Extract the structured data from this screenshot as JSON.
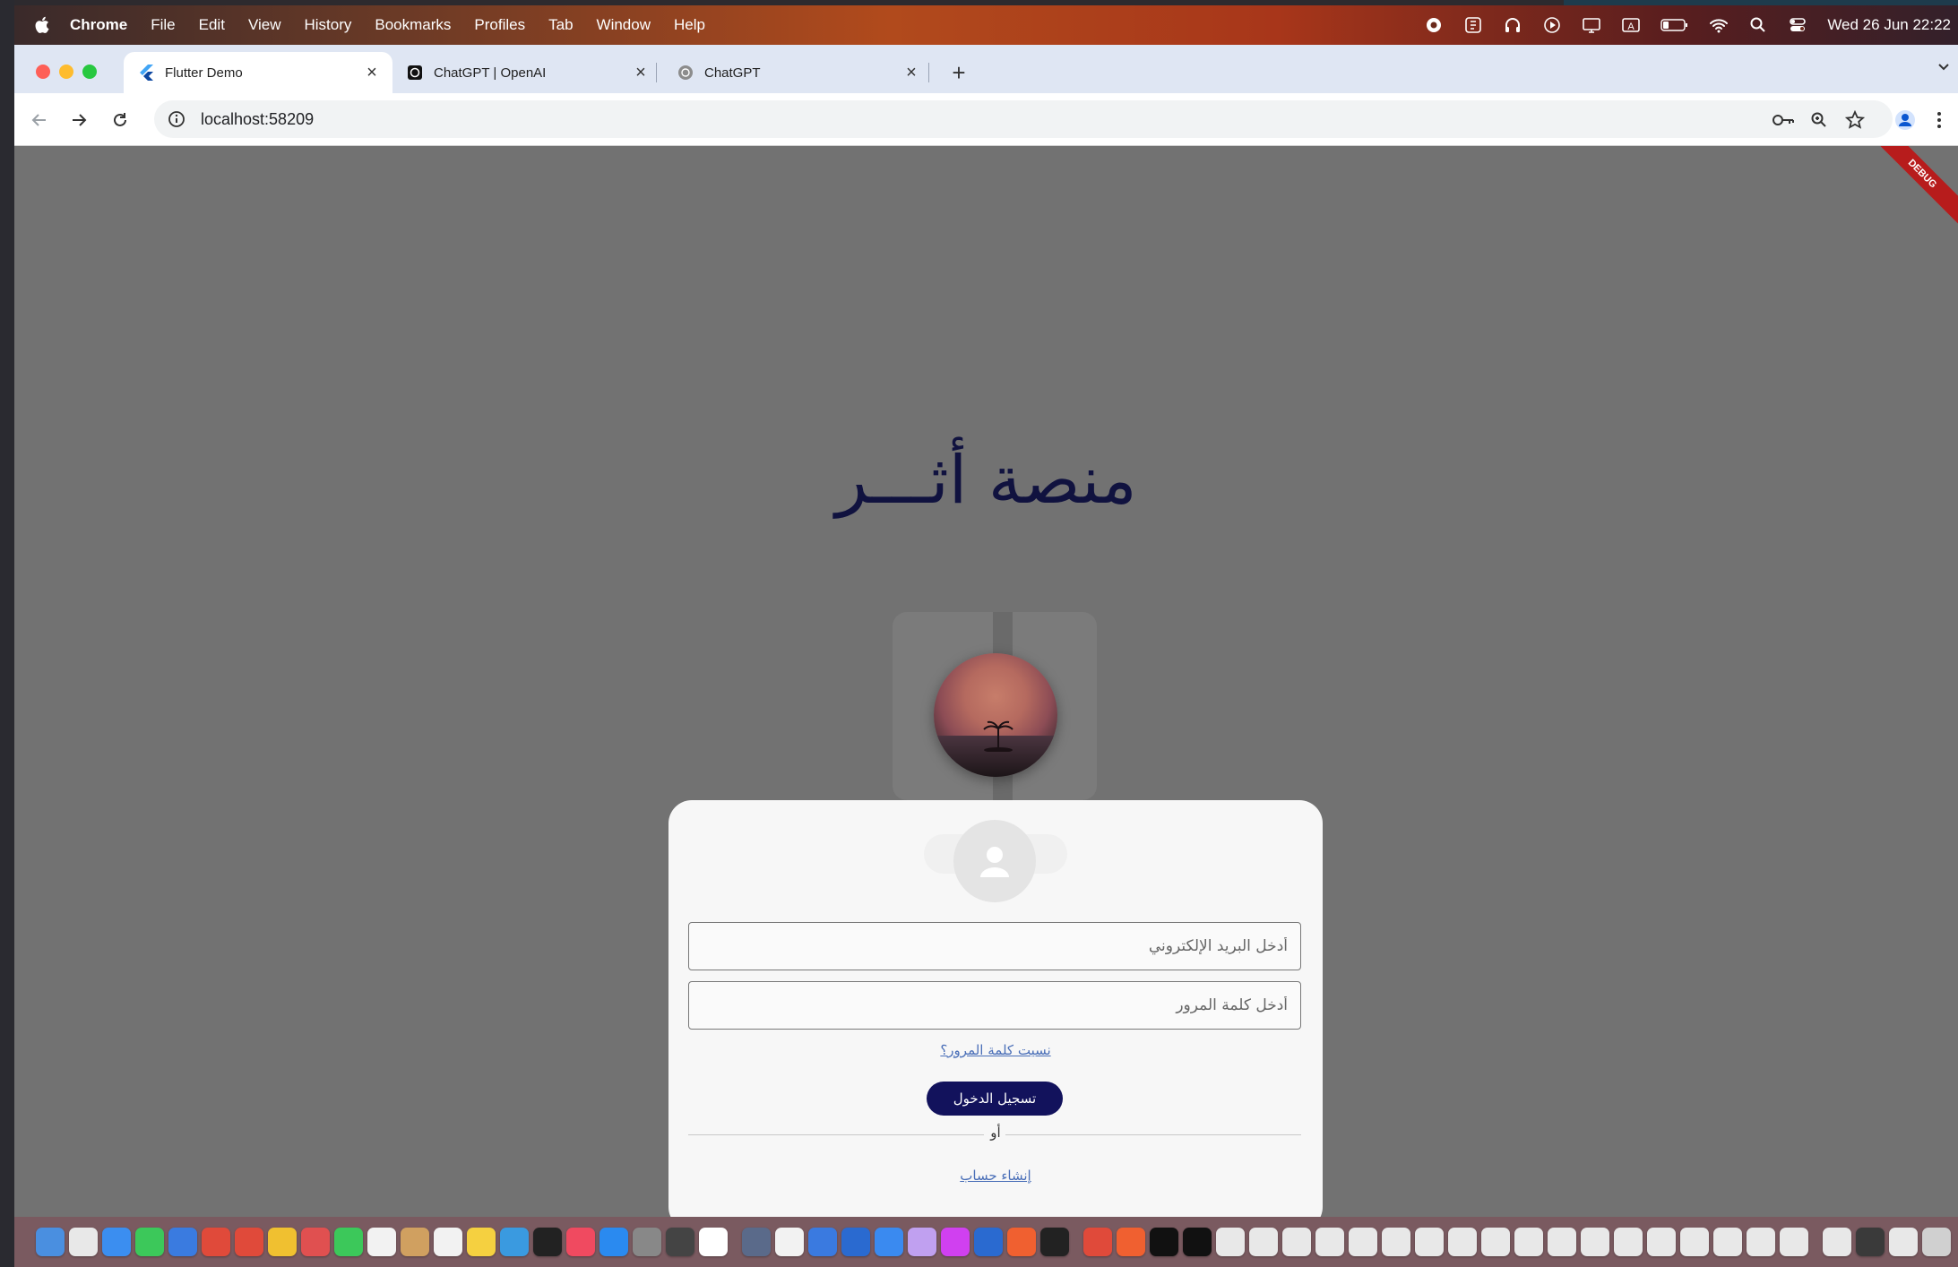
{
  "menubar": {
    "app_name": "Chrome",
    "items": [
      "File",
      "Edit",
      "View",
      "History",
      "Bookmarks",
      "Profiles",
      "Tab",
      "Window",
      "Help"
    ],
    "clock": "Wed 26 Jun  22:22",
    "status_icons": [
      "record-icon",
      "notes-icon",
      "headphones-icon",
      "play-icon",
      "display-icon",
      "keyboard-input-icon",
      "battery-icon",
      "wifi-icon",
      "search-icon",
      "control-center-icon"
    ]
  },
  "browser": {
    "tabs": [
      {
        "label": "Flutter Demo",
        "icon": "flutter-icon",
        "active": true
      },
      {
        "label": "ChatGPT | OpenAI",
        "icon": "openai-icon",
        "active": false
      },
      {
        "label": "ChatGPT",
        "icon": "openai-icon",
        "active": false
      }
    ],
    "tab_close": "×",
    "new_tab": "+",
    "url": "localhost:58209"
  },
  "page": {
    "title": "منصة أثـــر",
    "debug_banner": "DEBUG",
    "email_placeholder": "أدخل البريد الإلكتروني",
    "password_placeholder": "أدخل كلمة المرور",
    "forgot_password": "نسيت كلمة المرور؟",
    "login_button": "تسجيل الدخول",
    "or_text": "أو",
    "create_account": "إنشاء حساب"
  },
  "colors": {
    "accent": "#12125c",
    "title": "#10123f",
    "link": "#4a6fb8",
    "overlay": "#727272"
  },
  "dock": {
    "items": [
      "#4a8fe0",
      "#e8e8e8",
      "#3b8ef0",
      "#3cc85a",
      "#3a7be0",
      "#e04a3a",
      "#e04a3a",
      "#f0c030",
      "#e05050",
      "#3cc85a",
      "#f2f2f2",
      "#d0a060",
      "#f2f2f2",
      "#f5d040",
      "#3a9ae0",
      "#222222",
      "#f04a60",
      "#2a8af0",
      "#888888",
      "#444444",
      "#ffffff",
      "#5a6a8a",
      "#f2f2f2",
      "#3a7ae0",
      "#2a6ad0",
      "#3a8af0",
      "#c0a0f0",
      "#d040f0",
      "#2a6ad0",
      "#f06030",
      "#222222",
      "#e04a3a",
      "#f06030",
      "#111111",
      "#111111",
      "#e8e8e8",
      "#e8e8e8",
      "#e8e8e8",
      "#e8e8e8",
      "#e8e8e8",
      "#e8e8e8",
      "#e8e8e8",
      "#e8e8e8",
      "#e8e8e8",
      "#e8e8e8",
      "#e8e8e8",
      "#e8e8e8",
      "#e8e8e8",
      "#e8e8e8",
      "#e8e8e8",
      "#e8e8e8",
      "#e8e8e8",
      "#e8e8e8",
      "#e8e8e8",
      "#3a3a3a",
      "#e8e8e8",
      "#d0d0d0"
    ]
  }
}
